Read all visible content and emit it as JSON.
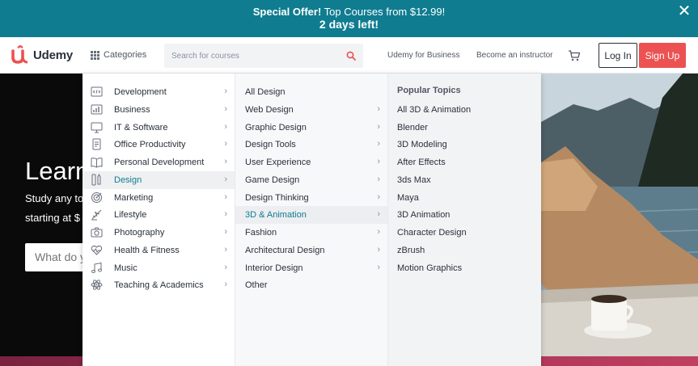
{
  "promo": {
    "offer_bold": "Special Offer!",
    "offer_text": " Top Courses from $12.99!",
    "countdown": "2 days left!",
    "close_glyph": "✕"
  },
  "header": {
    "logo_text": "Udemy",
    "categories_label": "Categories",
    "search_placeholder": "Search for courses",
    "business_link": "Udemy for Business",
    "instructor_link": "Become an instructor",
    "login_label": "Log In",
    "signup_label": "Sign Up"
  },
  "hero": {
    "title": "Learn",
    "subtitle_1": "Study any to",
    "subtitle_2": "starting at $",
    "search_placeholder": "What do y"
  },
  "menu": {
    "categories": [
      {
        "label": "Development",
        "icon": "code-icon"
      },
      {
        "label": "Business",
        "icon": "chart-icon"
      },
      {
        "label": "IT & Software",
        "icon": "monitor-icon"
      },
      {
        "label": "Office Productivity",
        "icon": "document-icon"
      },
      {
        "label": "Personal Development",
        "icon": "book-icon"
      },
      {
        "label": "Design",
        "icon": "pencil-ruler-icon"
      },
      {
        "label": "Marketing",
        "icon": "target-icon"
      },
      {
        "label": "Lifestyle",
        "icon": "plane-icon"
      },
      {
        "label": "Photography",
        "icon": "camera-icon"
      },
      {
        "label": "Health & Fitness",
        "icon": "heart-pulse-icon"
      },
      {
        "label": "Music",
        "icon": "music-note-icon"
      },
      {
        "label": "Teaching & Academics",
        "icon": "atom-icon"
      }
    ],
    "active_category": "Design",
    "subcategories": [
      {
        "label": "All Design",
        "has_arrow": false
      },
      {
        "label": "Web Design",
        "has_arrow": true
      },
      {
        "label": "Graphic Design",
        "has_arrow": true
      },
      {
        "label": "Design Tools",
        "has_arrow": true
      },
      {
        "label": "User Experience",
        "has_arrow": true
      },
      {
        "label": "Game Design",
        "has_arrow": true
      },
      {
        "label": "Design Thinking",
        "has_arrow": true
      },
      {
        "label": "3D & Animation",
        "has_arrow": true
      },
      {
        "label": "Fashion",
        "has_arrow": true
      },
      {
        "label": "Architectural Design",
        "has_arrow": true
      },
      {
        "label": "Interior Design",
        "has_arrow": true
      },
      {
        "label": "Other",
        "has_arrow": false
      }
    ],
    "active_subcategory": "3D & Animation",
    "topics_heading": "Popular Topics",
    "topics": [
      "All 3D & Animation",
      "Blender",
      "3D Modeling",
      "After Effects",
      "3ds Max",
      "Maya",
      "3D Animation",
      "Character Design",
      "zBrush",
      "Motion Graphics"
    ],
    "chevron_glyph": "›"
  },
  "colors": {
    "promo_bg": "#0f7c90",
    "brand_red": "#ec5252",
    "active_teal": "#0f7c90",
    "text_dark": "#29303b"
  }
}
